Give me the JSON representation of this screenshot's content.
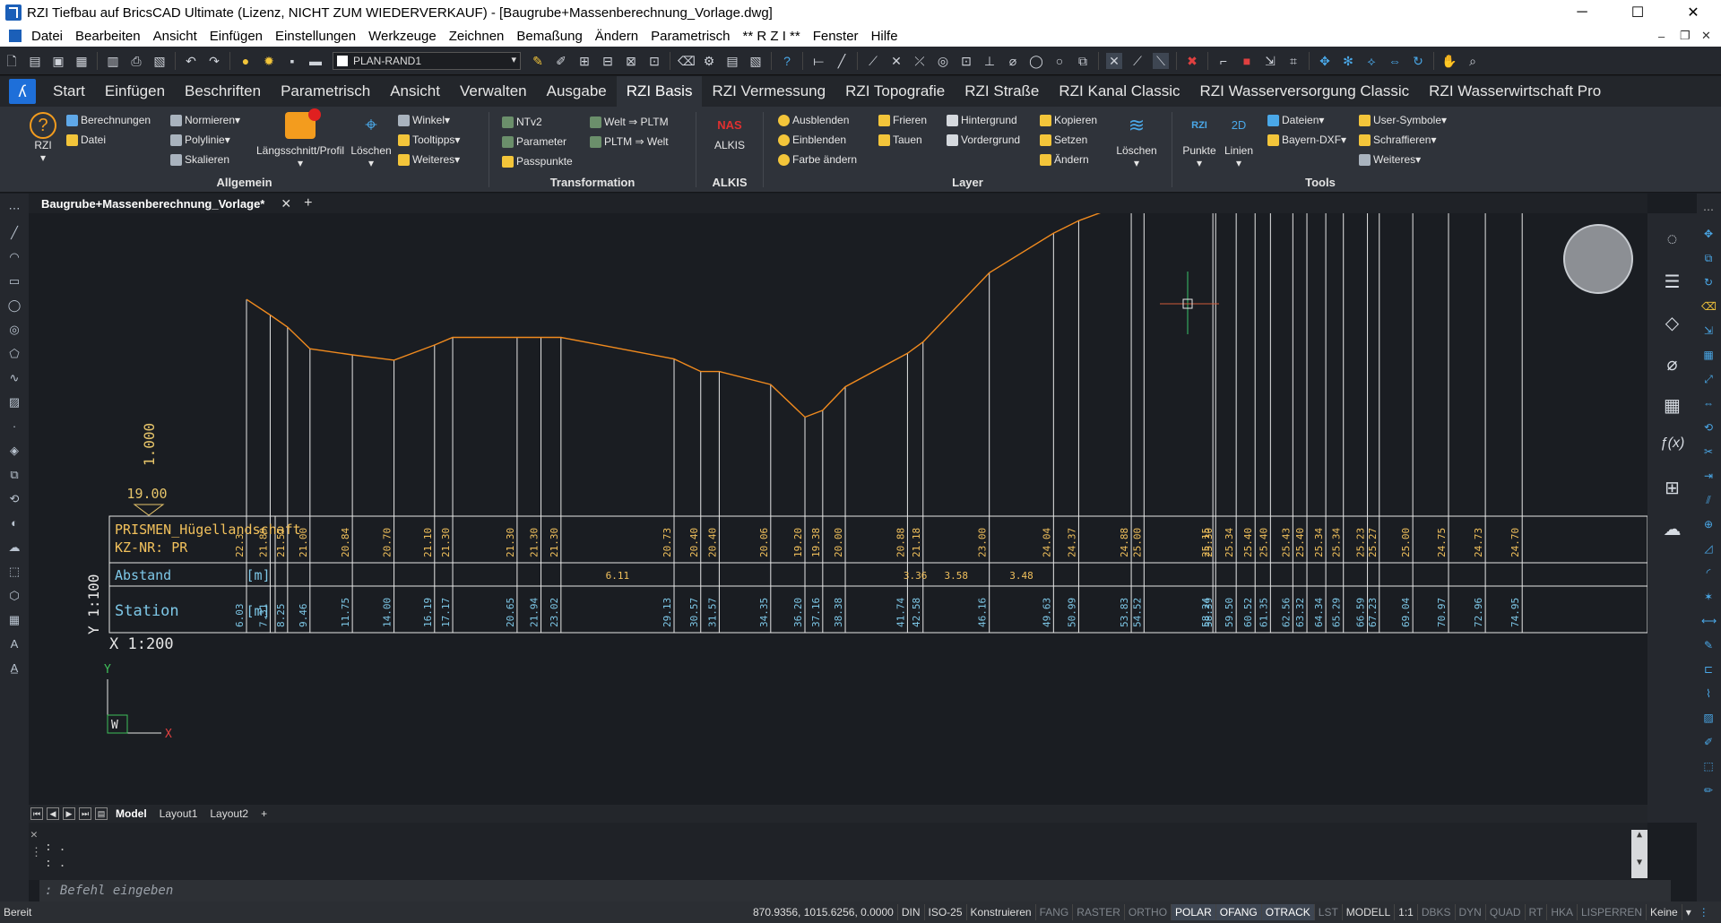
{
  "window": {
    "title": "RZI Tiefbau auf BricsCAD Ultimate (Lizenz, NICHT ZUM WIEDERVERKAUF) - [Baugrube+Massenberechnung_Vorlage.dwg]",
    "minimize": "─",
    "maximize": "☐",
    "close": "✕"
  },
  "menu": [
    "Datei",
    "Bearbeiten",
    "Ansicht",
    "Einfügen",
    "Einstellungen",
    "Werkzeuge",
    "Zeichnen",
    "Bemaßung",
    "Ändern",
    "Parametrisch",
    "** R Z I **",
    "Fenster",
    "Hilfe"
  ],
  "menu_window_controls": {
    "minimize": "–",
    "restore": "❐",
    "close": "✕"
  },
  "toolbar": {
    "layer_name": "PLAN-RAND1"
  },
  "ribbon_tabs": [
    "Start",
    "Einfügen",
    "Beschriften",
    "Parametrisch",
    "Ansicht",
    "Verwalten",
    "Ausgabe",
    "RZI Basis",
    "RZI Vermessung",
    "RZI Topografie",
    "RZI Straße",
    "RZI Kanal Classic",
    "RZI Wasserversorgung Classic",
    "RZI Wasserwirtschaft Pro"
  ],
  "ribbon_active": "RZI Basis",
  "ribbon": {
    "allgemein": {
      "label": "Allgemein",
      "rzi": "RZI",
      "berechnungen": "Berechnungen",
      "datei": "Datei",
      "normieren": "Normieren",
      "polylinie": "Polylinie",
      "skalieren": "Skalieren",
      "laengsschnitt": "Längsschnitt/Profil",
      "loeschen": "Löschen",
      "winkel": "Winkel",
      "tooltipps": "Tooltipps",
      "weiteres": "Weiteres"
    },
    "transformation": {
      "label": "Transformation",
      "ntv2": "NTv2",
      "parameter": "Parameter",
      "passpunkte": "Passpunkte",
      "welt_pltm": "Welt ⇒ PLTM",
      "pltm_welt": "PLTM ⇒ Welt"
    },
    "alkis": {
      "label": "ALKIS",
      "alkis": "ALKIS",
      "nas": "NAS"
    },
    "layer": {
      "label": "Layer",
      "ausblenden": "Ausblenden",
      "einblenden": "Einblenden",
      "farbe": "Farbe ändern",
      "frieren": "Frieren",
      "tauen": "Tauen",
      "hintergrund": "Hintergrund",
      "vordergrund": "Vordergrund",
      "kopieren": "Kopieren",
      "setzen": "Setzen",
      "aendern": "Ändern",
      "loeschen": "Löschen"
    },
    "tools": {
      "label": "Tools",
      "punkte": "Punkte",
      "linien": "Linien",
      "dateien": "Dateien",
      "bayern": "Bayern-DXF",
      "user": "User-Symbole",
      "schraffieren": "Schraffieren",
      "weiteres": "Weiteres"
    }
  },
  "document_tab": "Baugrube+Massenberechnung_Vorlage*",
  "drawing": {
    "vertical_scale_label": "1.000",
    "ref_height_label": "19.00",
    "band_title_1": "PRISMEN_Hügellandschaft",
    "band_title_2": "KZ-NR: PR",
    "row_abstand": "Abstand",
    "row_station": "Station",
    "unit": "[m]",
    "scale_y": "Y 1:100",
    "scale_x": "X 1:200",
    "ucs_y": "Y",
    "ucs_x": "X",
    "ucs_w": "W"
  },
  "chart_data": {
    "type": "line",
    "series": [
      {
        "x": [
          6.03,
          7.31,
          8.25,
          9.46,
          11.75,
          14.0,
          16.19,
          17.17,
          20.65,
          21.94,
          23.02,
          29.13,
          30.57,
          31.57,
          34.35,
          36.2,
          37.16,
          38.38,
          41.74,
          42.58,
          46.16,
          49.63,
          50.99,
          53.83,
          54.52,
          58.24,
          58.39,
          59.5,
          60.52,
          61.35,
          62.56,
          63.32,
          64.34,
          65.29,
          66.59,
          67.23,
          69.04,
          70.97,
          72.96,
          74.95
        ],
        "heights": [
          "22.3",
          "21.89",
          "21.57",
          "21.00",
          "20.84",
          "20.70",
          "21.10",
          "21.30",
          "21.30",
          "21.30",
          "21.30",
          "20.73",
          "20.40",
          "20.40",
          "20.06",
          "19.20",
          "19.38",
          "20.00",
          "20.88",
          "21.18",
          "23.00",
          "24.04",
          "24.37",
          "24.88",
          "25.00",
          "25.15",
          "25.30",
          "25.34",
          "25.40",
          "25.40",
          "25.43",
          "25.40",
          "25.34",
          "25.34",
          "25.23",
          "25.27",
          "25.00",
          "24.75",
          "24.73",
          "24.70"
        ],
        "stations": [
          "6.03",
          "7.31",
          "8.25",
          "9.46",
          "11.75",
          "14.00",
          "16.19",
          "17.17",
          "20.65",
          "21.94",
          "23.02",
          "29.13",
          "30.57",
          "31.57",
          "34.35",
          "36.20",
          "37.16",
          "38.38",
          "41.74",
          "42.58",
          "46.16",
          "49.63",
          "50.99",
          "53.83",
          "54.52",
          "58.24",
          "58.39",
          "59.50",
          "60.52",
          "61.35",
          "62.56",
          "63.32",
          "64.34",
          "65.29",
          "66.59",
          "67.23",
          "69.04",
          "70.97",
          "72.96",
          "74.95"
        ]
      }
    ],
    "abstand": [
      {
        "after": 10,
        "label": "6.11"
      },
      {
        "after": 18,
        "label": "3.36"
      },
      {
        "after": 19,
        "label": "3.58"
      },
      {
        "after": 20,
        "label": "3.48"
      }
    ],
    "ref_height": 19.0
  },
  "layout_tabs": [
    "Model",
    "Layout1",
    "Layout2",
    "+"
  ],
  "command": {
    "line1": ": .",
    "line2": ": .",
    "prompt": ": Befehl eingeben"
  },
  "status": {
    "ready": "Bereit",
    "coords": "870.9356, 1015.6256, 0.0000",
    "items": [
      {
        "t": "DIN",
        "s": "n"
      },
      {
        "t": "ISO-25",
        "s": "n"
      },
      {
        "t": "Konstruieren",
        "s": "n"
      },
      {
        "t": "FANG",
        "s": "off"
      },
      {
        "t": "RASTER",
        "s": "off"
      },
      {
        "t": "ORTHO",
        "s": "off"
      },
      {
        "t": "POLAR",
        "s": "on"
      },
      {
        "t": "OFANG",
        "s": "on"
      },
      {
        "t": "OTRACK",
        "s": "on"
      },
      {
        "t": "LST",
        "s": "off"
      },
      {
        "t": "MODELL",
        "s": "n"
      },
      {
        "t": "1:1",
        "s": "n"
      },
      {
        "t": "DBKS",
        "s": "off"
      },
      {
        "t": "DYN",
        "s": "off"
      },
      {
        "t": "QUAD",
        "s": "off"
      },
      {
        "t": "RT",
        "s": "off"
      },
      {
        "t": "HKA",
        "s": "off"
      },
      {
        "t": "LISPERREN",
        "s": "off"
      },
      {
        "t": "Keine",
        "s": "n"
      }
    ]
  },
  "colors": {
    "profile": "#f08a1e",
    "grid": "#e6e6e6",
    "band_text": "#f2c15c",
    "station_text": "#7ec8e8",
    "annotation": "#e6c46a",
    "crosshair": "#38c26a"
  }
}
